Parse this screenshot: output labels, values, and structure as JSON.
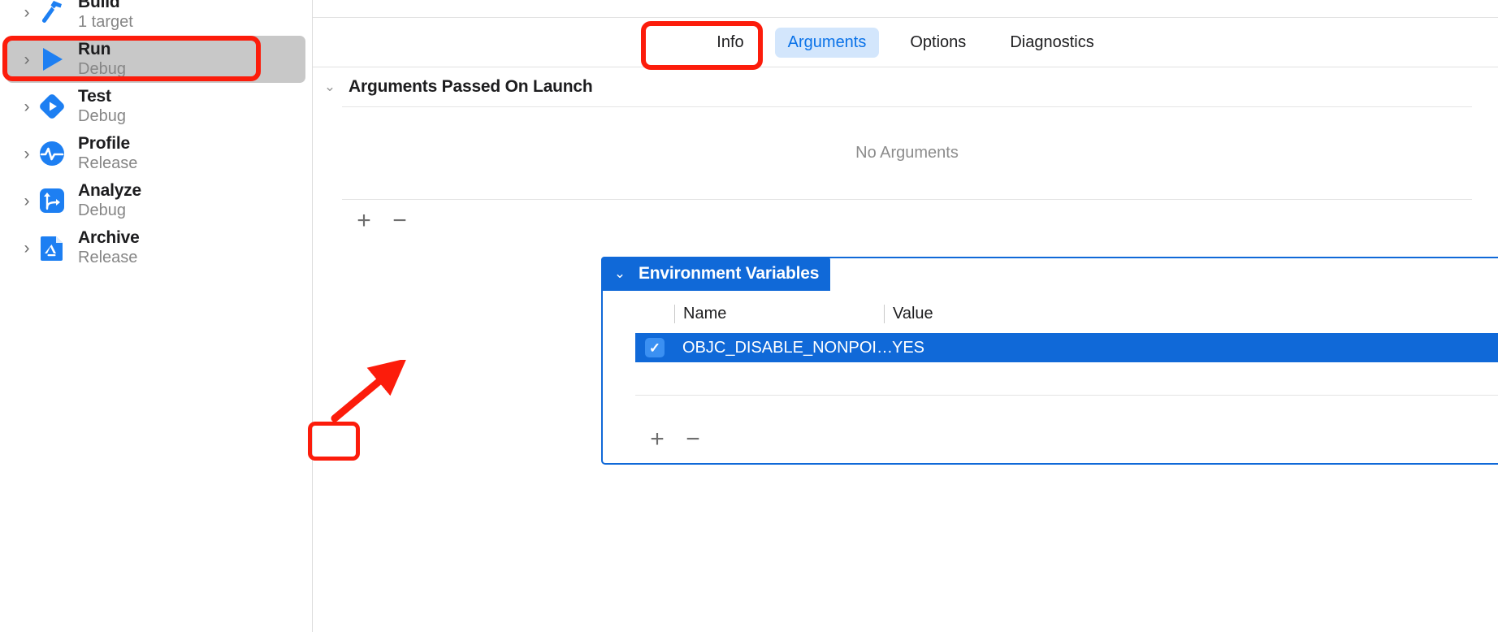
{
  "sidebar": {
    "items": [
      {
        "title": "Build",
        "subtitle": "1 target",
        "icon": "hammer-icon",
        "selected": false
      },
      {
        "title": "Run",
        "subtitle": "Debug",
        "icon": "play-triangle-icon",
        "selected": true
      },
      {
        "title": "Test",
        "subtitle": "Debug",
        "icon": "test-diamond-icon",
        "selected": false
      },
      {
        "title": "Profile",
        "subtitle": "Release",
        "icon": "pulse-circle-icon",
        "selected": false
      },
      {
        "title": "Analyze",
        "subtitle": "Debug",
        "icon": "analyze-arrows-icon",
        "selected": false
      },
      {
        "title": "Archive",
        "subtitle": "Release",
        "icon": "archive-app-icon",
        "selected": false
      }
    ],
    "disclosure_glyph": "›"
  },
  "main": {
    "tabs": [
      {
        "label": "Info",
        "active": false
      },
      {
        "label": "Arguments",
        "active": true
      },
      {
        "label": "Options",
        "active": false
      },
      {
        "label": "Diagnostics",
        "active": false
      }
    ],
    "arguments_section": {
      "chevron": "⌄",
      "title": "Arguments Passed On Launch",
      "empty_text": "No Arguments",
      "add_label": "+",
      "remove_label": "−"
    },
    "environment_section": {
      "chevron": "⌄",
      "title": "Environment Variables",
      "columns": [
        "Name",
        "Value"
      ],
      "rows": [
        {
          "checked": true,
          "name": "OBJC_DISABLE_NONPOI…",
          "value": "YES",
          "selected": true
        }
      ],
      "add_label": "+",
      "remove_label": "−"
    }
  },
  "colors": {
    "accent_blue": "#1069d8",
    "tab_active_bg": "#d3e6fc",
    "tab_active_text": "#0a72e8",
    "annotation_red": "#fc1c0b",
    "selected_row_bg": "#c8c8c8"
  }
}
